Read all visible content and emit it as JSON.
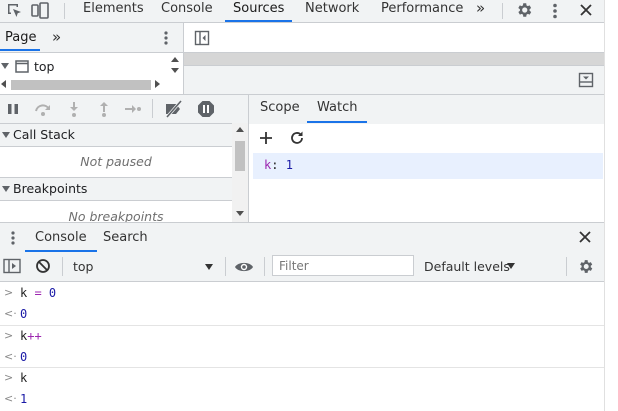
{
  "tabs": {
    "items": [
      "Elements",
      "Console",
      "Sources",
      "Network",
      "Performance"
    ],
    "more": "»",
    "active": "Sources"
  },
  "navigator": {
    "tab": "Page",
    "more": "»",
    "tree": [
      {
        "label": "top",
        "icon": "frame-icon"
      }
    ]
  },
  "debugger": {
    "sections": [
      {
        "title": "Call Stack",
        "message": "Not paused"
      },
      {
        "title": "Breakpoints",
        "message": "No breakpoints"
      }
    ]
  },
  "sidebar": {
    "tabs": [
      "Scope",
      "Watch"
    ],
    "active": "Watch",
    "watch": [
      {
        "expr": "k",
        "sep": ":",
        "value": "1"
      }
    ]
  },
  "drawer": {
    "tabs": [
      "Console",
      "Search"
    ],
    "active": "Console"
  },
  "console_toolbar": {
    "context": "top",
    "filter_placeholder": "Filter",
    "levels": "Default levels"
  },
  "console": {
    "entries": [
      {
        "input": {
          "ident": "k",
          "op": " = ",
          "num": "0"
        },
        "result": "0"
      },
      {
        "input": {
          "ident": "k",
          "op": "++",
          "num": ""
        },
        "result": "0"
      },
      {
        "input": {
          "ident": "k",
          "op": "",
          "num": ""
        },
        "result": "1"
      }
    ]
  },
  "colors": {
    "accent": "#1a73e8",
    "number": "#1a1aa6",
    "watch_row": "#e8f0fe"
  }
}
